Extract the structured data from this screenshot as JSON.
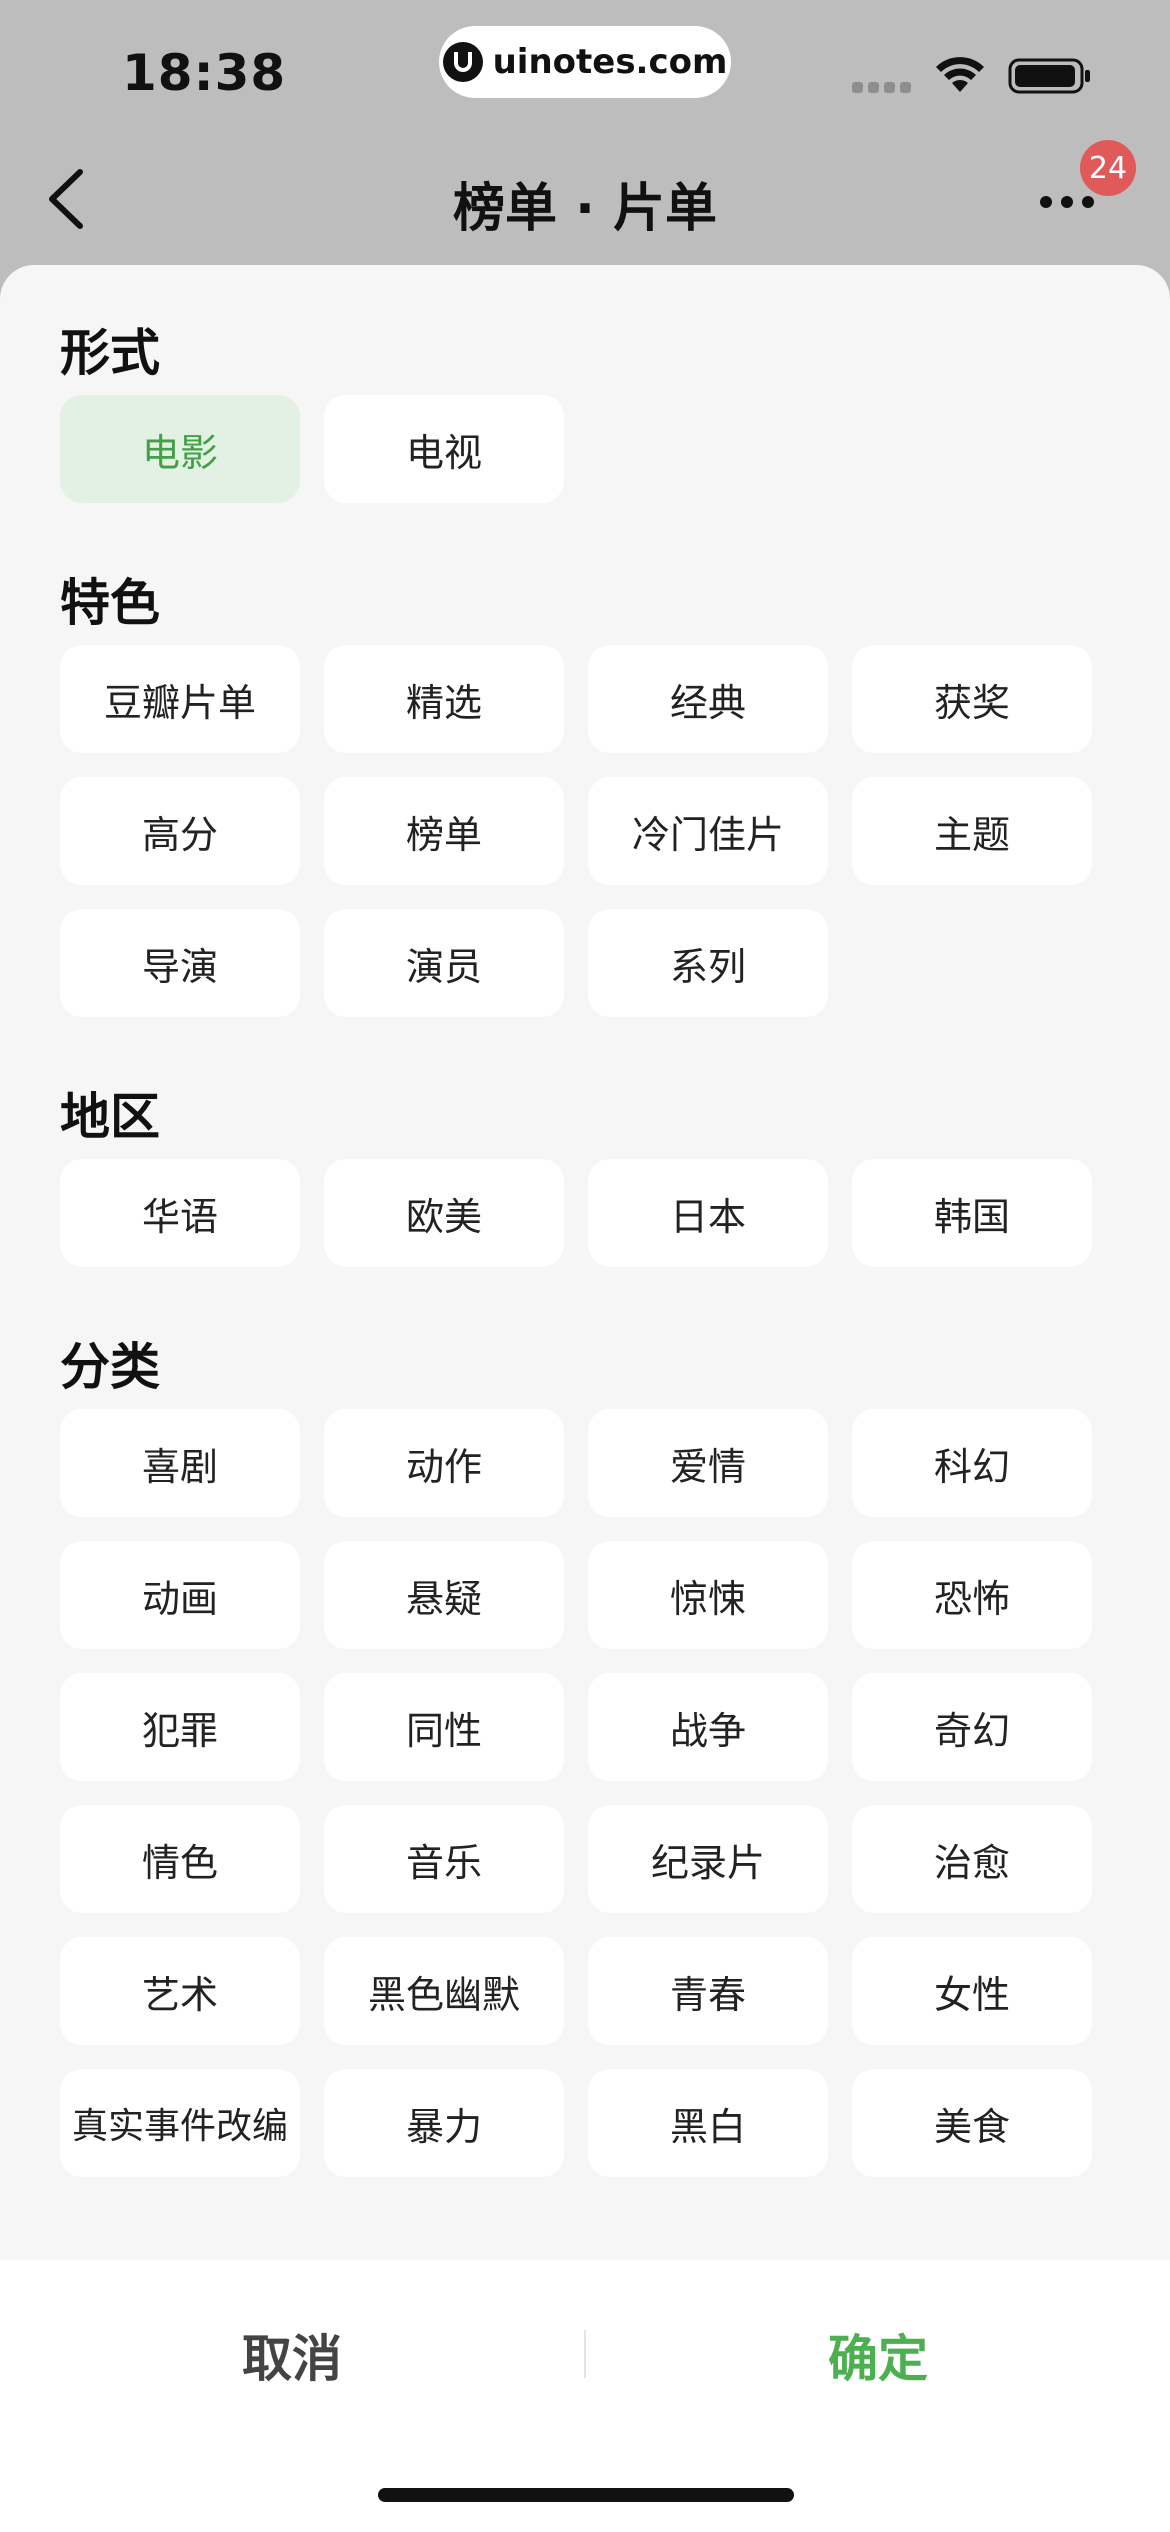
{
  "status_bar": {
    "time": "18:38",
    "url": "uinotes.com"
  },
  "nav": {
    "title": "榜单 · 片单",
    "badge": "24"
  },
  "sections": [
    {
      "title": "形式",
      "items": [
        {
          "label": "电影",
          "selected": true
        },
        {
          "label": "电视",
          "selected": false
        }
      ]
    },
    {
      "title": "特色",
      "items": [
        {
          "label": "豆瓣片单"
        },
        {
          "label": "精选"
        },
        {
          "label": "经典"
        },
        {
          "label": "获奖"
        },
        {
          "label": "高分"
        },
        {
          "label": "榜单"
        },
        {
          "label": "冷门佳片"
        },
        {
          "label": "主题"
        },
        {
          "label": "导演"
        },
        {
          "label": "演员"
        },
        {
          "label": "系列"
        }
      ]
    },
    {
      "title": "地区",
      "items": [
        {
          "label": "华语"
        },
        {
          "label": "欧美"
        },
        {
          "label": "日本"
        },
        {
          "label": "韩国"
        }
      ]
    },
    {
      "title": "分类",
      "items": [
        {
          "label": "喜剧"
        },
        {
          "label": "动作"
        },
        {
          "label": "爱情"
        },
        {
          "label": "科幻"
        },
        {
          "label": "动画"
        },
        {
          "label": "悬疑"
        },
        {
          "label": "惊悚"
        },
        {
          "label": "恐怖"
        },
        {
          "label": "犯罪"
        },
        {
          "label": "同性"
        },
        {
          "label": "战争"
        },
        {
          "label": "奇幻"
        },
        {
          "label": "情色"
        },
        {
          "label": "音乐"
        },
        {
          "label": "纪录片"
        },
        {
          "label": "治愈"
        },
        {
          "label": "艺术"
        },
        {
          "label": "黑色幽默"
        },
        {
          "label": "青春"
        },
        {
          "label": "女性"
        },
        {
          "label": "真实事件改编"
        },
        {
          "label": "暴力"
        },
        {
          "label": "黑白"
        },
        {
          "label": "美食"
        }
      ]
    }
  ],
  "actions": {
    "cancel": "取消",
    "confirm": "确定"
  },
  "colors": {
    "accent": "#4caf50",
    "selected_bg": "#e2f1e3",
    "badge": "#e15a5a"
  }
}
